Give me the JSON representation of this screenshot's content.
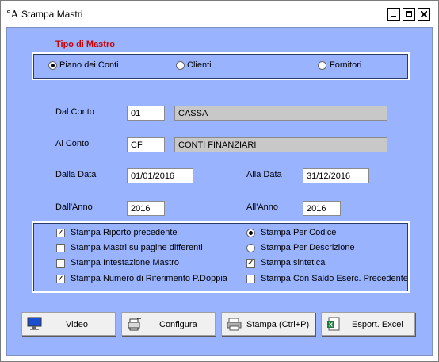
{
  "window": {
    "title": "Stampa Mastri",
    "icon": "app-letter-a-icon"
  },
  "tipo_mastro": {
    "heading": "Tipo di Mastro",
    "options": [
      {
        "label": "Piano dei Conti",
        "selected": true
      },
      {
        "label": "Clienti",
        "selected": false
      },
      {
        "label": "Fornitori",
        "selected": false
      }
    ]
  },
  "dal_conto": {
    "label": "Dal Conto",
    "code": "01",
    "description": "CASSA"
  },
  "al_conto": {
    "label": "Al Conto",
    "code": "CF",
    "description": "CONTI FINANZIARI"
  },
  "dalla_data": {
    "label": "Dalla Data",
    "value": "01/01/2016"
  },
  "alla_data": {
    "label": "Alla Data",
    "value": "31/12/2016"
  },
  "dall_anno": {
    "label": "Dall'Anno",
    "value": "2016"
  },
  "all_anno": {
    "label": "All'Anno",
    "value": "2016"
  },
  "options_left": [
    {
      "label": "Stampa Riporto precedente",
      "checked": true
    },
    {
      "label": "Stampa Mastri su pagine differenti",
      "checked": false
    },
    {
      "label": "Stampa Intestazione Mastro",
      "checked": false
    },
    {
      "label": "Stampa Numero di Riferimento P.Doppia",
      "checked": true
    }
  ],
  "options_right": [
    {
      "label": "Stampa Per Codice",
      "type": "radio",
      "checked": true
    },
    {
      "label": "Stampa Per Descrizione",
      "type": "radio",
      "checked": false
    },
    {
      "label": "Stampa sintetica",
      "type": "checkbox",
      "checked": true
    },
    {
      "label": "Stampa Con Saldo Eserc. Precedente",
      "type": "checkbox",
      "checked": false
    }
  ],
  "buttons": {
    "video": "Video",
    "configura": "Configura",
    "stampa": "Stampa (Ctrl+P)",
    "excel": "Esport. Excel"
  },
  "colors": {
    "client_bg": "#99b3ff",
    "heading": "#cc0000"
  }
}
